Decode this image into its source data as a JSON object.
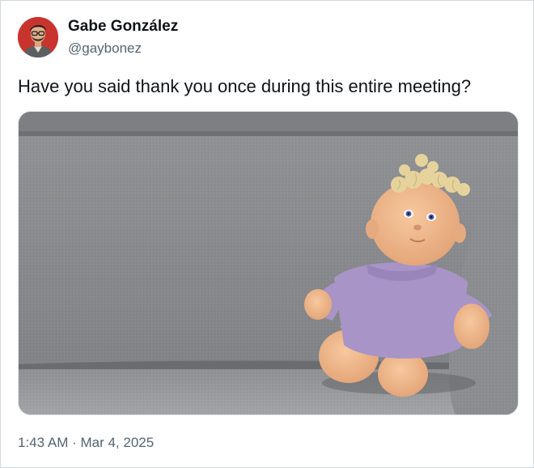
{
  "user": {
    "display_name": "Gabe González",
    "handle": "@gaybonez"
  },
  "tweet": {
    "text": "Have you said thank you once during this entire meeting?",
    "timestamp": "1:43 AM · Mar 4, 2025"
  },
  "media": {
    "subject_icon": "doll-on-couch-photo"
  },
  "colors": {
    "text_primary": "#0f1419",
    "text_secondary": "#536471",
    "border": "#cfd9de",
    "avatar_bg": "#c9302c"
  }
}
